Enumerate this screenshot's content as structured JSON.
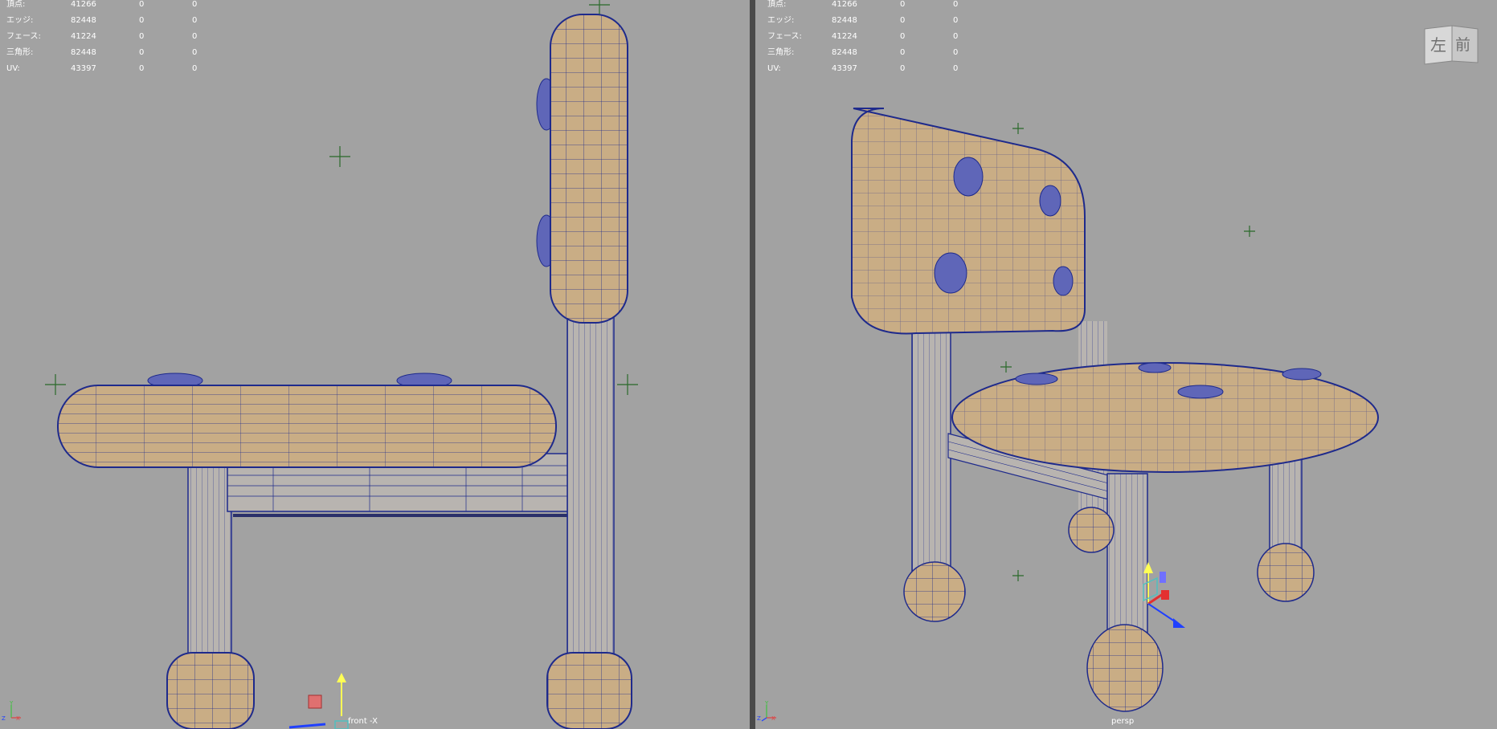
{
  "hud_rows": [
    {
      "label": "頂点:",
      "value": "41266",
      "a": "0",
      "b": "0"
    },
    {
      "label": "エッジ:",
      "value": "82448",
      "a": "0",
      "b": "0"
    },
    {
      "label": "フェース:",
      "value": "41224",
      "a": "0",
      "b": "0"
    },
    {
      "label": "三角形:",
      "value": "82448",
      "a": "0",
      "b": "0"
    },
    {
      "label": "UV:",
      "value": "43397",
      "a": "0",
      "b": "0"
    }
  ],
  "left_viewport": {
    "camera": "front -X"
  },
  "right_viewport": {
    "camera": "persp"
  },
  "viewcube": {
    "left_face": "左",
    "front_face": "前"
  },
  "axis_labels": {
    "y": "Y",
    "z": "Z",
    "x": "X"
  },
  "colors": {
    "viewport_bg": "#a2a2a2",
    "mesh_fill": "#c9ad85",
    "wire": "#1e2a8c",
    "button_fill": "#5f66b8",
    "manipulator_y": "#ffff55",
    "manipulator_x": "#e33030",
    "manipulator_z": "#2040ff"
  }
}
